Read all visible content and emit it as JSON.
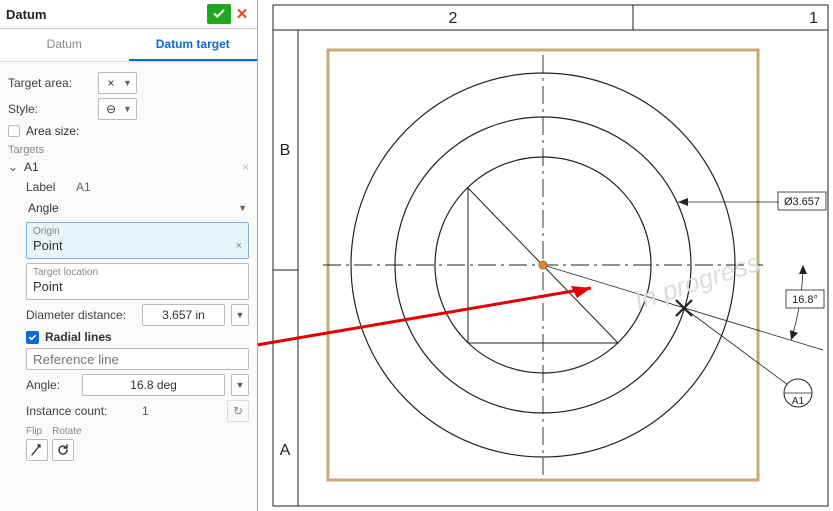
{
  "panel": {
    "title": "Datum",
    "tabs": {
      "datum": "Datum",
      "datum_target": "Datum target"
    },
    "target_area_label": "Target area:",
    "target_area_symbol": "×",
    "style_label": "Style:",
    "style_symbol": "⊖",
    "area_size_label": "Area size:",
    "targets_section": "Targets",
    "target_name": "A1",
    "label_label": "Label",
    "label_value": "A1",
    "angle_type": "Angle",
    "origin_label": "Origin",
    "origin_value": "Point",
    "target_location_label": "Target location",
    "target_location_value": "Point",
    "diameter_distance_label": "Diameter distance:",
    "diameter_distance_value": "3.657 in",
    "radial_lines_label": "Radial lines",
    "reference_line_placeholder": "Reference line",
    "angle_label": "Angle:",
    "angle_value": "16.8 deg",
    "instance_count_label": "Instance count:",
    "instance_count_value": "1",
    "flip_label": "Flip",
    "rotate_label": "Rotate"
  },
  "drawing": {
    "col_left": "2",
    "col_right": "1",
    "row_top": "B",
    "row_bottom": "A",
    "diameter_callout": "Ø3.657",
    "angle_callout": "16.8°",
    "datum_balloon": "A1",
    "watermark": "In progress"
  },
  "colors": {
    "accent": "#0a6bd6",
    "ok": "#1fa81f",
    "cancel": "#e64a19",
    "frame": "#c9a97a"
  }
}
